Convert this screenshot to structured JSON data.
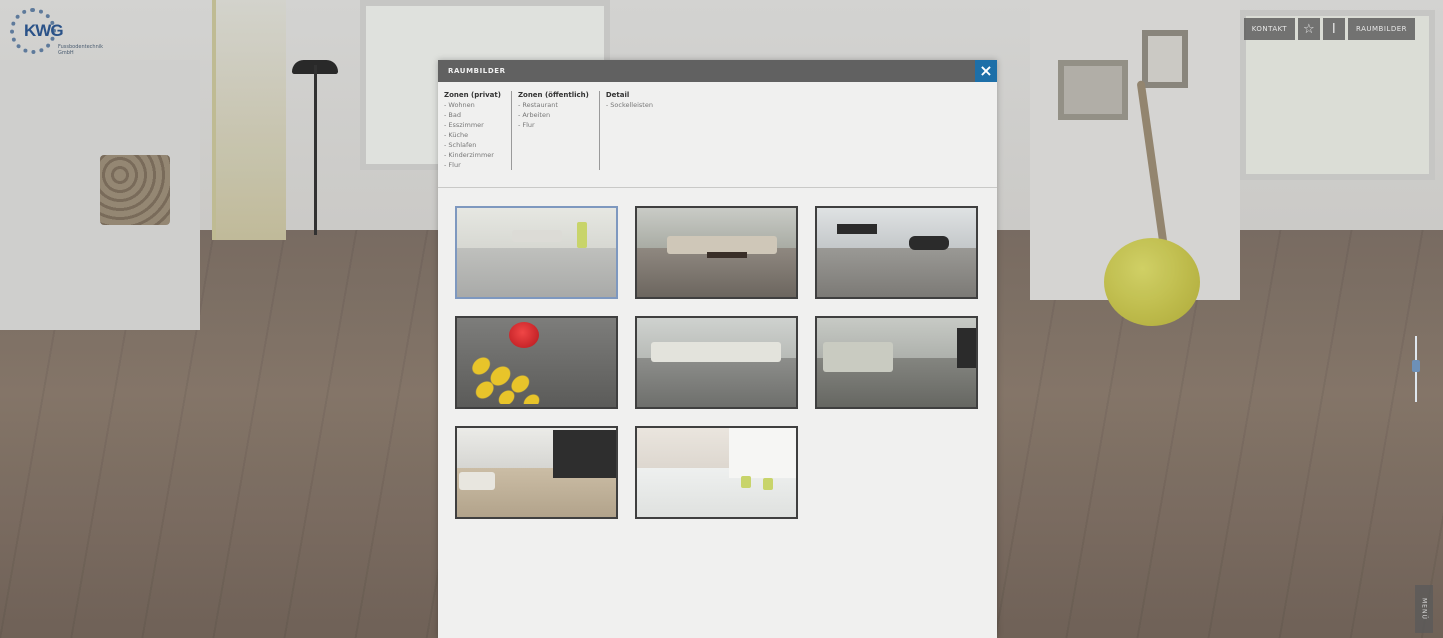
{
  "logo": {
    "text": "KWG",
    "subtitle": "Fussbodentechnik GmbH"
  },
  "toolbar": {
    "left_label": "KONTAKT",
    "star_icon": "star-icon",
    "info_symbol": "i",
    "right_label": "RAUMBILDER"
  },
  "side_tab": {
    "label": "MENÜ"
  },
  "modal": {
    "title": "RAUMBILDER",
    "close_symbol": "×",
    "filters": [
      {
        "heading": "Zonen (privat)",
        "items": [
          "- Wohnen",
          "- Bad",
          "- Esszimmer",
          "- Küche",
          "- Schlafen",
          "- Kinderzimmer",
          "- Flur"
        ]
      },
      {
        "heading": "Zonen (öffentlich)",
        "items": [
          "- Restaurant",
          "- Arbeiten",
          "- Flur"
        ]
      },
      {
        "heading": "Detail",
        "items": [
          "- Sockelleisten"
        ]
      }
    ],
    "thumbnails": [
      {
        "scene": "bright-living-room-grey-floor",
        "selected": true
      },
      {
        "scene": "living-room-sofa-dark-wood-floor",
        "selected": false
      },
      {
        "scene": "black-lounge-chair-grey-floor",
        "selected": false
      },
      {
        "scene": "red-chair-yellow-rug",
        "selected": false
      },
      {
        "scene": "white-sectional-sofa",
        "selected": false
      },
      {
        "scene": "grey-sofa-living-room",
        "selected": false
      },
      {
        "scene": "tv-wall-light-oak-floor",
        "selected": false
      },
      {
        "scene": "green-chairs-white-room",
        "selected": false
      }
    ]
  },
  "colors": {
    "modal_header": "#616161",
    "close_button": "#1d6fa8",
    "modal_body": "#f0f0ef",
    "selected_border": "#7e98bf"
  }
}
